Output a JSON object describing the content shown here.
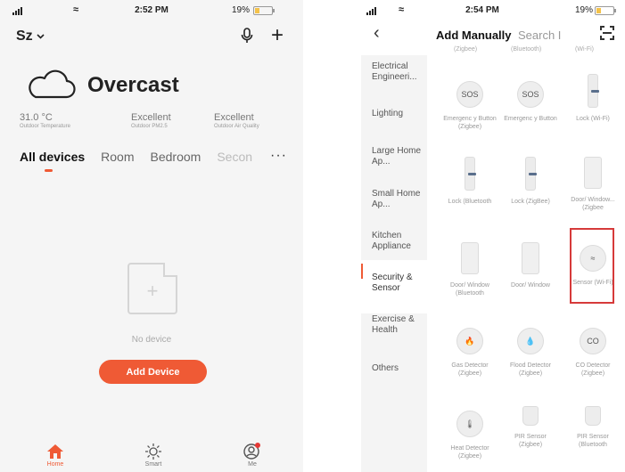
{
  "left": {
    "status": {
      "time": "2:52 PM",
      "battery": "19%"
    },
    "home_name": "Sz",
    "weather": {
      "condition": "Overcast",
      "metrics": [
        {
          "value": "31.0 °C",
          "label": "Outdoor Temperature"
        },
        {
          "value": "Excellent",
          "label": "Outdoor PM2.5"
        },
        {
          "value": "Excellent",
          "label": "Outdoor Air Quality"
        }
      ]
    },
    "tabs": [
      "All devices",
      "Room",
      "Bedroom",
      "Secon"
    ],
    "tab_more": "···",
    "empty_text": "No device",
    "add_device": "Add Device",
    "nav": [
      {
        "label": "Home",
        "icon": "home-icon"
      },
      {
        "label": "Smart",
        "icon": "sun-icon"
      },
      {
        "label": "Me",
        "icon": "profile-icon"
      }
    ],
    "accent": "#ef5a35"
  },
  "right": {
    "status": {
      "time": "2:54 PM",
      "battery": "19%"
    },
    "header": {
      "active_tab": "Add Manually",
      "search_tab": "Search I"
    },
    "categories": [
      "Electrical Engineeri...",
      "Lighting",
      "Large Home Ap...",
      "Small Home Ap...",
      "Kitchen Appliance",
      "Security & Sensor",
      "Exercise & Health",
      "Others"
    ],
    "active_category": "Security & Sensor",
    "cutoff_labels": [
      "(Zigbee)",
      "(Bluetooth)",
      "(Wi-Fi)"
    ],
    "devices": [
      {
        "name": "Emergenc y Button (Zigbee)",
        "glyph": "SOS"
      },
      {
        "name": "Emergenc y Button",
        "glyph": "SOS"
      },
      {
        "name": "Lock (Wi-Fi)",
        "glyph": ""
      },
      {
        "name": "Lock (Bluetooth",
        "glyph": ""
      },
      {
        "name": "Lock (ZigBee)",
        "glyph": ""
      },
      {
        "name": "Door/ Window... (Zigbee",
        "glyph": ""
      },
      {
        "name": "Door/ Window (Bluetooth",
        "glyph": ""
      },
      {
        "name": "Door/ Window",
        "glyph": ""
      },
      {
        "name": "Sensor (Wi-Fi)",
        "glyph": "≈"
      },
      {
        "name": "Gas Detector (Zigbee)",
        "glyph": "🔥"
      },
      {
        "name": "Flood Detector (Zigbee)",
        "glyph": "💧"
      },
      {
        "name": "CO Detector (Zigbee)",
        "glyph": "CO"
      },
      {
        "name": "Heat Detector (Zigbee)",
        "glyph": "🌡"
      },
      {
        "name": "PIR Sensor (Zigbee)",
        "glyph": ""
      },
      {
        "name": "PIR Sensor (Bluetooth",
        "glyph": ""
      }
    ],
    "selected_device": "Sensor (Wi-Fi)",
    "highlight_color": "#d63a3a"
  }
}
